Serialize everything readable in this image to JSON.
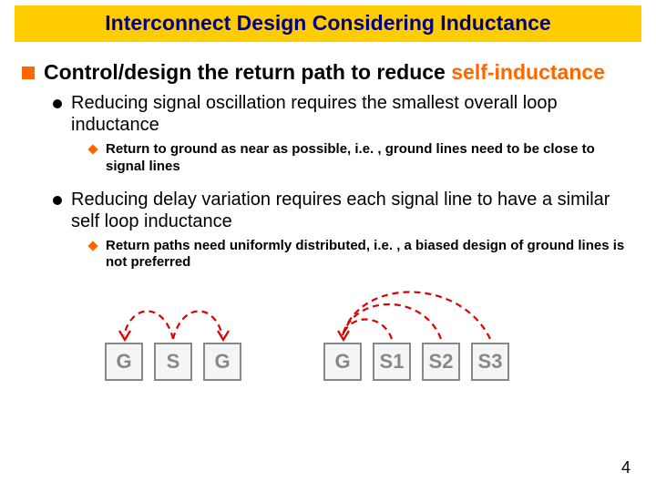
{
  "title": "Interconnect Design Considering Inductance",
  "page_number": "4",
  "h1_plain": "Control/design the return path to reduce ",
  "h1_accent": "self-inductance",
  "bullets": {
    "b1": "Reducing signal oscillation requires the smallest overall loop inductance",
    "b1_sub": "Return to ground as near as possible, i.e. , ground lines need to be close to signal lines",
    "b2": "Reducing delay variation requires each signal line to have a similar self loop inductance",
    "b2_sub": "Return paths need uniformly distributed, i.e. , a biased design of ground lines is not preferred"
  },
  "diagram": {
    "left_group": [
      "G",
      "S",
      "G"
    ],
    "right_group": [
      "G",
      "S1",
      "S2",
      "S3"
    ]
  }
}
